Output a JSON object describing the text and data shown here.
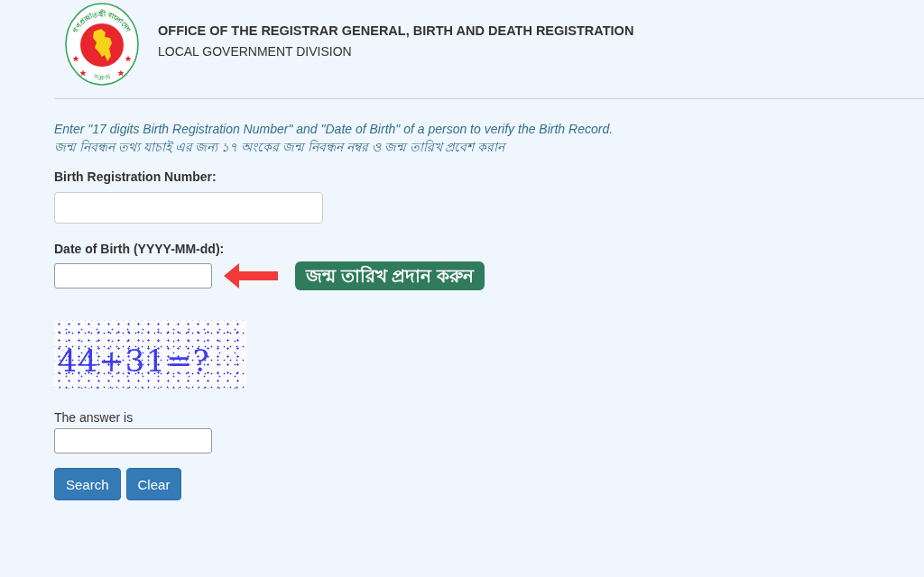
{
  "header": {
    "logo": {
      "top_text": "গণপ্রজাতন্ত্রী বাংলাদেশ",
      "bottom_text": "সরকার"
    },
    "title": "OFFICE OF THE REGISTRAR GENERAL, BIRTH AND DEATH REGISTRATION",
    "subtitle": "LOCAL GOVERNMENT DIVISION"
  },
  "instructions": [
    "Enter \"17 digits Birth Registration Number\" and \"Date of Birth\" of a person to verify the Birth Record.",
    "জন্ম নিবন্ধন তথ্য যাচাই এর জন্য ১৭ অংকের জন্ম নিবন্ধন নম্বর ও জন্ম তারিখ প্রবেশ করান"
  ],
  "birth_registration_number": {
    "label": "Birth Registration Number:"
  },
  "date_of_birth": {
    "label": "Date of Birth (YYYY-MM-dd):",
    "annotation": "জন্ম তারিখ প্রদান করুন"
  },
  "captcha": {
    "text": "44+31=?"
  },
  "answer": {
    "label": "The answer is"
  },
  "buttons": [
    "Search",
    "Clear"
  ]
}
